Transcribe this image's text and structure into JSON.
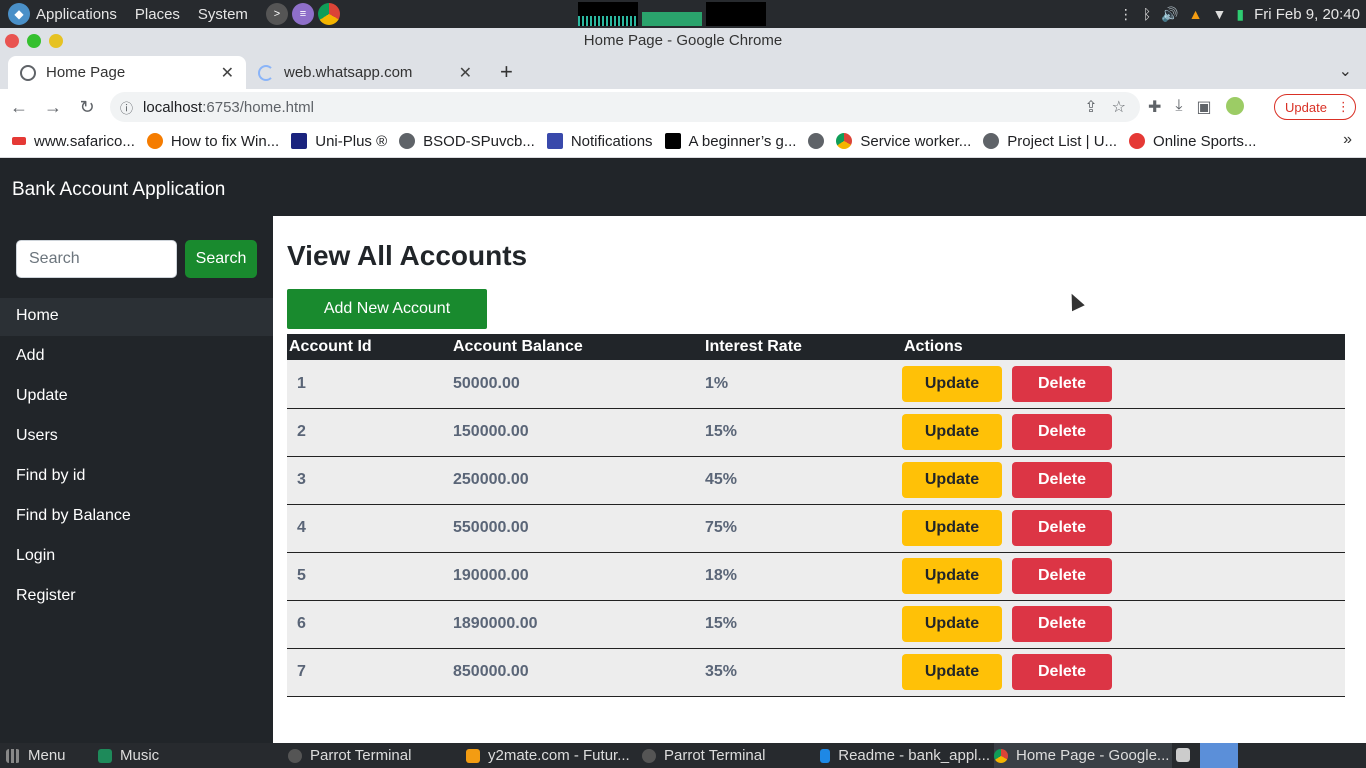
{
  "os_panel": {
    "menus": [
      "Applications",
      "Places",
      "System"
    ],
    "clock": "Fri Feb 9, 20:40"
  },
  "window": {
    "title": "Home Page - Google Chrome"
  },
  "tabs": [
    {
      "label": "Home Page",
      "active": true
    },
    {
      "label": "web.whatsapp.com",
      "active": false
    }
  ],
  "address_bar": {
    "host": "localhost",
    "path": ":6753/home.html"
  },
  "browser": {
    "update_label": "Update"
  },
  "bookmarks": [
    "www.safarico...",
    "How to fix Win...",
    "Uni-Plus ®",
    "BSOD-SPuvcb...",
    "Notifications",
    "A beginner’s g...",
    "",
    "Service worker...",
    "Project List | U...",
    "Online Sports..."
  ],
  "app": {
    "brand": "Bank Account Application",
    "search_placeholder": "Search",
    "search_button": "Search",
    "nav": [
      "Home",
      "Add",
      "Update",
      "Users",
      "Find by id",
      "Find by Balance",
      "Login",
      "Register"
    ],
    "heading": "View All Accounts",
    "add_button": "Add New Account",
    "columns": [
      "Account Id",
      "Account Balance",
      "Interest Rate",
      "Actions"
    ],
    "update_label": "Update",
    "delete_label": "Delete",
    "rows": [
      {
        "id": "1",
        "balance": "50000.00",
        "rate": "1%"
      },
      {
        "id": "2",
        "balance": "150000.00",
        "rate": "15%"
      },
      {
        "id": "3",
        "balance": "250000.00",
        "rate": "45%"
      },
      {
        "id": "4",
        "balance": "550000.00",
        "rate": "75%"
      },
      {
        "id": "5",
        "balance": "190000.00",
        "rate": "18%"
      },
      {
        "id": "6",
        "balance": "1890000.00",
        "rate": "15%"
      },
      {
        "id": "7",
        "balance": "850000.00",
        "rate": "35%"
      }
    ]
  },
  "taskbar": {
    "menu": "Menu",
    "items": [
      "Music",
      "Parrot Terminal",
      "y2mate.com - Futur...",
      "Parrot Terminal",
      "Readme - bank_appl...",
      "Home Page - Google..."
    ]
  },
  "colors": {
    "navbar": "#212529",
    "success": "#198a2e",
    "warning": "#ffc107",
    "danger": "#dc3545"
  }
}
